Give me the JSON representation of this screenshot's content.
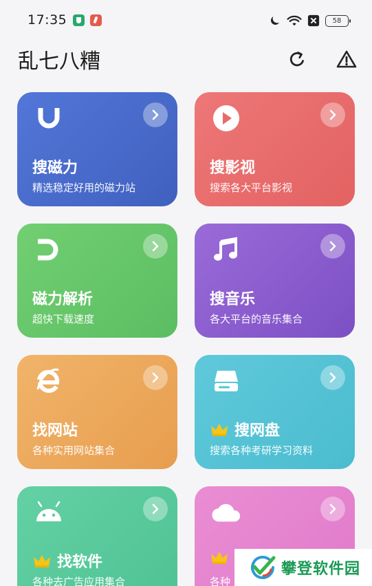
{
  "status_bar": {
    "time": "17:35",
    "battery": "58",
    "icons": [
      "moon-icon",
      "wifi-icon",
      "sim-icon",
      "battery-icon"
    ]
  },
  "header": {
    "title": "乱七八糟",
    "actions": [
      "refresh-icon",
      "warning-icon"
    ]
  },
  "cards": [
    {
      "title": "搜磁力",
      "subtitle": "精选稳定好用的磁力站",
      "icon": "magnet-u-icon",
      "color": "#4a6ccc"
    },
    {
      "title": "搜影视",
      "subtitle": "搜索各大平台影视",
      "icon": "play-icon",
      "color": "#e86b6b"
    },
    {
      "title": "磁力解析",
      "subtitle": "超快下载速度",
      "icon": "magnet-icon",
      "color": "#66c66a"
    },
    {
      "title": "搜音乐",
      "subtitle": "各大平台的音乐集合",
      "icon": "music-note-icon",
      "color": "#8a5ccf"
    },
    {
      "title": "找网站",
      "subtitle": "各种实用网站集合",
      "icon": "ie-browser-icon",
      "color": "#eca85b"
    },
    {
      "title": "搜网盘",
      "subtitle": "搜索各种考研学习资料",
      "icon": "hard-drive-icon",
      "color": "#55c3d6",
      "crown": true
    },
    {
      "title": "找软件",
      "subtitle": "各种去广告应用集合",
      "icon": "android-icon",
      "color": "#59ca9c",
      "crown": true
    },
    {
      "title": "",
      "subtitle": "各种",
      "icon": "cloud-icon",
      "color": "#e584cf",
      "crown": true
    }
  ],
  "watermark": {
    "text": "攀登软件园"
  }
}
